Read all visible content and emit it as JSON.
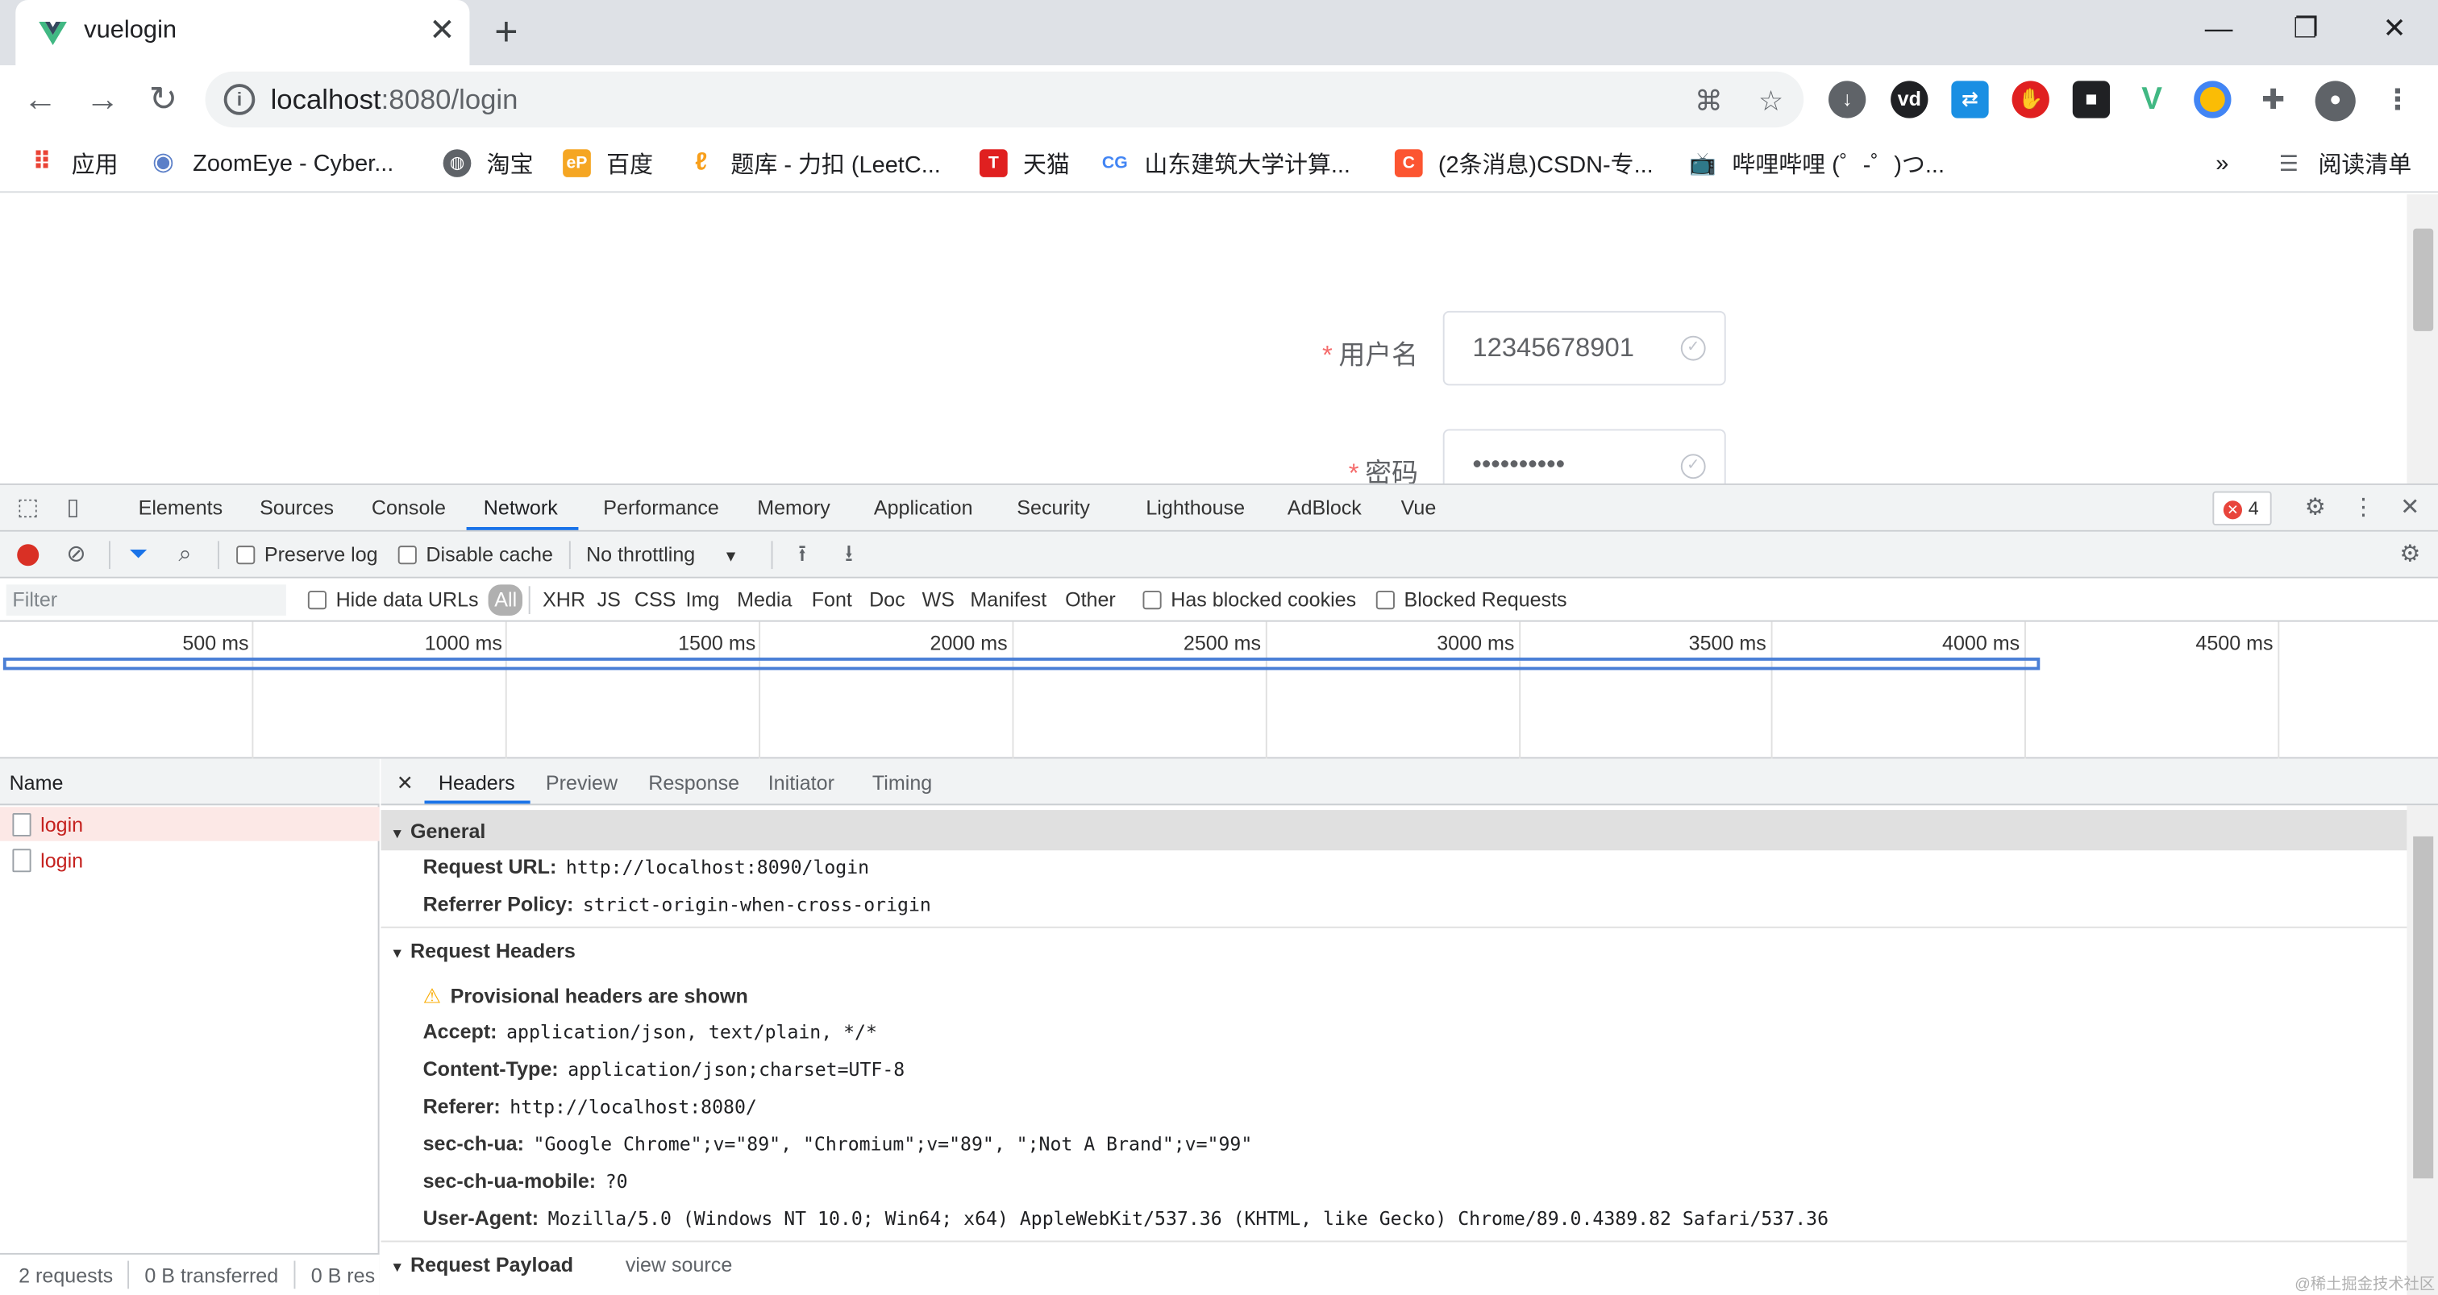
{
  "browser": {
    "tab_title": "vuelogin",
    "tab_close": "✕",
    "new_tab": "+",
    "url_host": "localhost",
    "url_path": ":8080/login",
    "window_controls": [
      "—",
      "❐",
      "✕"
    ]
  },
  "bookmarks": [
    {
      "label": "应用",
      "icon": "apps-grid-icon",
      "color": "#ea4335"
    },
    {
      "label": "ZoomEye - Cyber...",
      "icon": "zoomeye-icon",
      "color": "#5b7fc8"
    },
    {
      "label": "淘宝",
      "icon": "globe-icon",
      "color": "#5f6368"
    },
    {
      "label": "百度",
      "icon": "ep-icon",
      "color": "#f5a623"
    },
    {
      "label": "题库 - 力扣 (LeetC...",
      "icon": "leetcode-icon",
      "color": "#f89f1b"
    },
    {
      "label": "天猫",
      "icon": "tmall-icon",
      "color": "#e02020"
    },
    {
      "label": "山东建筑大学计算...",
      "icon": "cg-icon",
      "color": "#4285f4"
    },
    {
      "label": "(2条消息)CSDN-专...",
      "icon": "csdn-icon",
      "color": "#fc5531"
    },
    {
      "label": "哔哩哔哩 (゜-゜)つ...",
      "icon": "bilibili-icon",
      "color": "#00a1d6"
    }
  ],
  "bookmarks_more": "»",
  "reading_list": "阅读清单",
  "login_form": {
    "username_label": "用户名",
    "username_value": "12345678901",
    "password_label": "密码",
    "password_value": "••••••••••",
    "required_mark": "*"
  },
  "devtools": {
    "tabs": [
      "Elements",
      "Sources",
      "Console",
      "Network",
      "Performance",
      "Memory",
      "Application",
      "Security",
      "Lighthouse",
      "AdBlock",
      "Vue"
    ],
    "active_tab": "Network",
    "error_count": "4",
    "toolbar": {
      "preserve_log": "Preserve log",
      "disable_cache": "Disable cache",
      "throttling": "No throttling"
    },
    "filter": {
      "placeholder": "Filter",
      "hide_data_urls": "Hide data URLs",
      "types": [
        "All",
        "XHR",
        "JS",
        "CSS",
        "Img",
        "Media",
        "Font",
        "Doc",
        "WS",
        "Manifest",
        "Other"
      ],
      "has_blocked_cookies": "Has blocked cookies",
      "blocked_requests": "Blocked Requests"
    },
    "timeline_ticks": [
      "500 ms",
      "1000 ms",
      "1500 ms",
      "2000 ms",
      "2500 ms",
      "3000 ms",
      "3500 ms",
      "4000 ms",
      "4500 ms"
    ],
    "name_header": "Name",
    "requests": [
      "login",
      "login"
    ],
    "status": {
      "requests": "2 requests",
      "transferred": "0 B transferred",
      "resources": "0 B res"
    },
    "detail_tabs": [
      "Headers",
      "Preview",
      "Response",
      "Initiator",
      "Timing"
    ],
    "general": {
      "title": "General",
      "request_url_key": "Request URL:",
      "request_url": "http://localhost:8090/login",
      "referrer_policy_key": "Referrer Policy:",
      "referrer_policy": "strict-origin-when-cross-origin"
    },
    "request_headers": {
      "title": "Request Headers",
      "warning": "Provisional headers are shown",
      "items": [
        {
          "k": "Accept:",
          "v": "application/json, text/plain, */*"
        },
        {
          "k": "Content-Type:",
          "v": "application/json;charset=UTF-8"
        },
        {
          "k": "Referer:",
          "v": "http://localhost:8080/"
        },
        {
          "k": "sec-ch-ua:",
          "v": "\"Google Chrome\";v=\"89\", \"Chromium\";v=\"89\", \";Not A Brand\";v=\"99\""
        },
        {
          "k": "sec-ch-ua-mobile:",
          "v": "?0"
        },
        {
          "k": "User-Agent:",
          "v": "Mozilla/5.0 (Windows NT 10.0; Win64; x64) AppleWebKit/537.36 (KHTML, like Gecko) Chrome/89.0.4389.82 Safari/537.36"
        }
      ]
    },
    "request_payload": {
      "title": "Request Payload",
      "view_source": "view source"
    }
  },
  "watermark": "@稀土掘金技术社区"
}
